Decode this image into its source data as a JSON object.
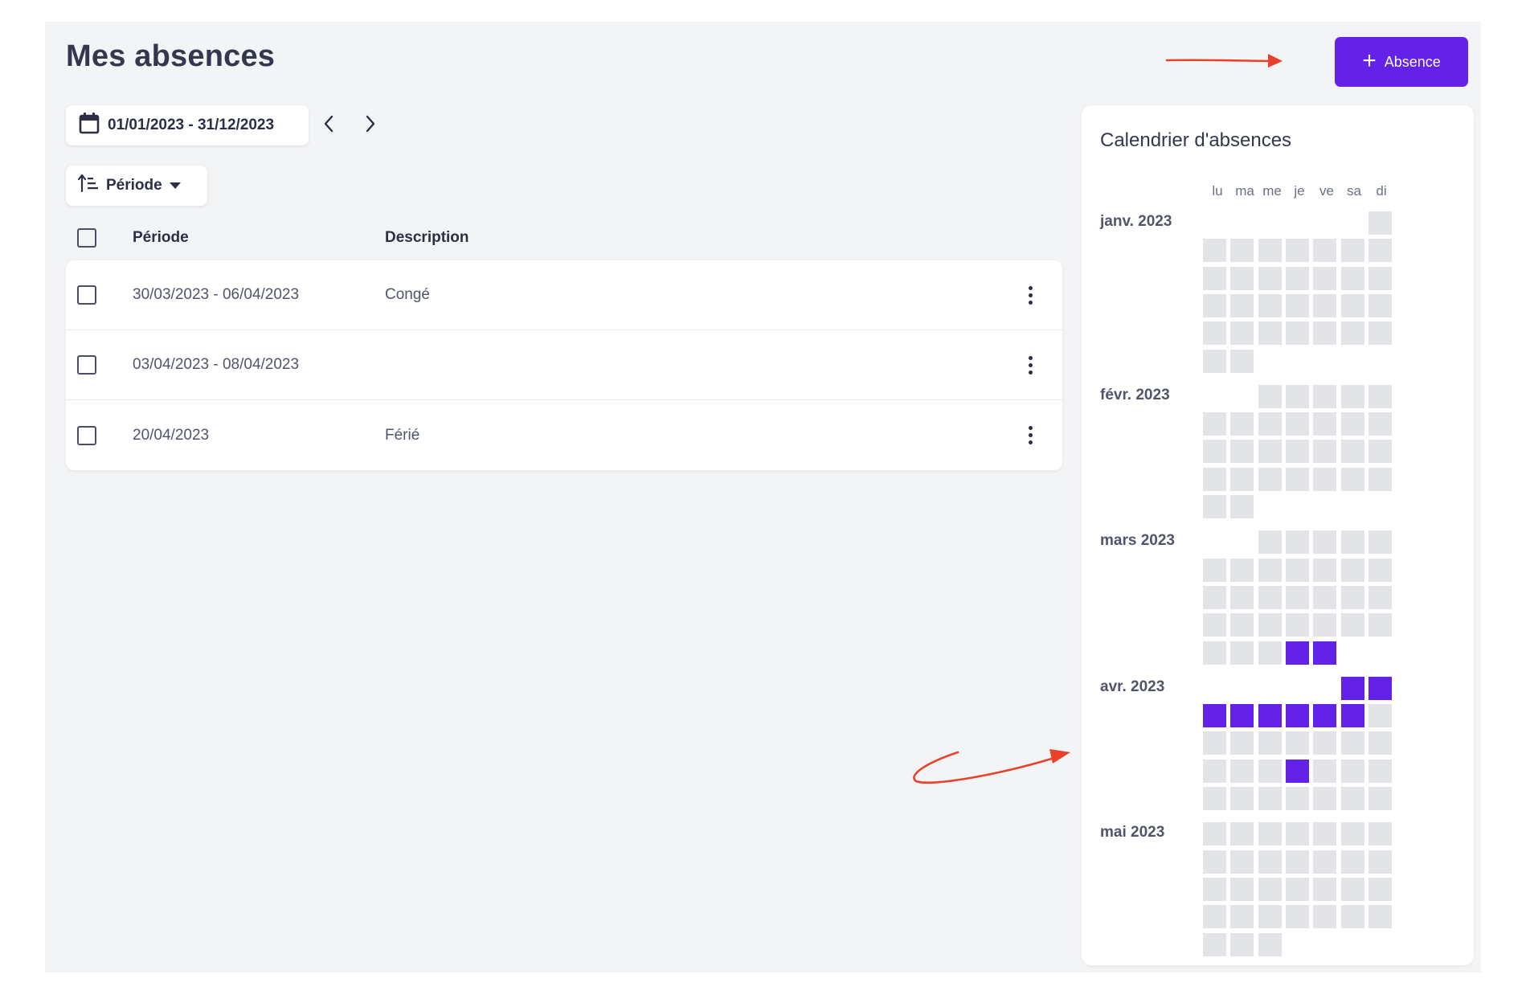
{
  "page": {
    "title": "Mes absences"
  },
  "toolbar": {
    "add_label": "Absence",
    "add_icon": "plus-icon",
    "date_range": "01/01/2023 - 31/12/2023",
    "date_icon": "calendar-icon",
    "prev_icon": "chevron-left-icon",
    "next_icon": "chevron-right-icon",
    "sort_label": "Période",
    "sort_icon": "sort-ascending-icon",
    "sort_caret_icon": "caret-down-icon"
  },
  "table": {
    "headers": {
      "period": "Période",
      "description": "Description"
    },
    "rows": [
      {
        "period": "30/03/2023 - 06/04/2023",
        "description": "Congé"
      },
      {
        "period": "03/04/2023 - 08/04/2023",
        "description": ""
      },
      {
        "period": "20/04/2023",
        "description": "Férié"
      }
    ]
  },
  "calendar": {
    "title": "Calendrier d'absences",
    "day_labels": [
      "lu",
      "ma",
      "me",
      "je",
      "ve",
      "sa",
      "di"
    ],
    "months": [
      {
        "label": "janv. 2023",
        "first_weekday": 6,
        "days": 31,
        "absent_days": []
      },
      {
        "label": "févr. 2023",
        "first_weekday": 2,
        "days": 28,
        "absent_days": []
      },
      {
        "label": "mars 2023",
        "first_weekday": 2,
        "days": 31,
        "absent_days": [
          30,
          31
        ]
      },
      {
        "label": "avr. 2023",
        "first_weekday": 5,
        "days": 30,
        "absent_days": [
          1,
          2,
          3,
          4,
          5,
          6,
          7,
          8,
          20
        ]
      },
      {
        "label": "mai 2023",
        "first_weekday": 0,
        "days": 31,
        "absent_days": []
      }
    ]
  },
  "colors": {
    "accent": "#6422e9",
    "empty_cell": "#e3e4e7",
    "annotation": "#e8412c",
    "background": "#f3f4f6"
  }
}
